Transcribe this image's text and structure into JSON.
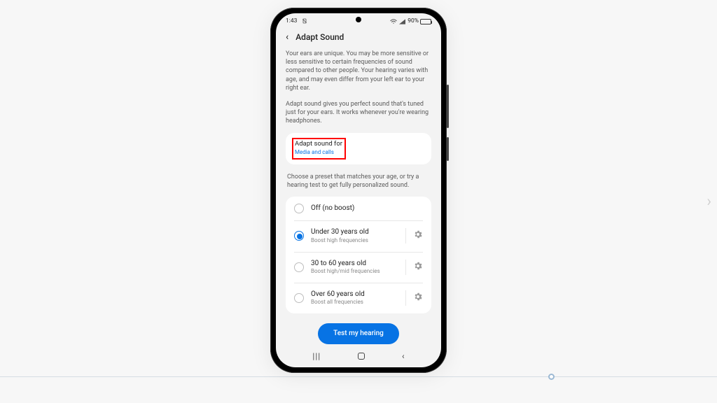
{
  "status": {
    "time": "1:43",
    "battery_pct": "90%"
  },
  "header": {
    "title": "Adapt Sound"
  },
  "intro": {
    "p1": "Your ears are unique. You may be more sensitive or less sensitive to certain frequencies of sound compared to other people. Your hearing varies with age, and may even differ from your left ear to your right ear.",
    "p2": "Adapt sound gives you perfect sound that's tuned just for your ears. It works whenever you're wearing headphones."
  },
  "target": {
    "title": "Adapt sound for",
    "value": "Media and calls"
  },
  "preset_note": "Choose a preset that matches your age, or try a hearing test to get fully personalized sound.",
  "options": [
    {
      "title": "Off (no boost)",
      "sub": "",
      "checked": false,
      "gear": false
    },
    {
      "title": "Under 30 years old",
      "sub": "Boost high frequencies",
      "checked": true,
      "gear": true
    },
    {
      "title": "30 to 60 years old",
      "sub": "Boost high/mid frequencies",
      "checked": false,
      "gear": true
    },
    {
      "title": "Over 60 years old",
      "sub": "Boost all frequencies",
      "checked": false,
      "gear": true
    }
  ],
  "cta": {
    "label": "Test my hearing"
  }
}
